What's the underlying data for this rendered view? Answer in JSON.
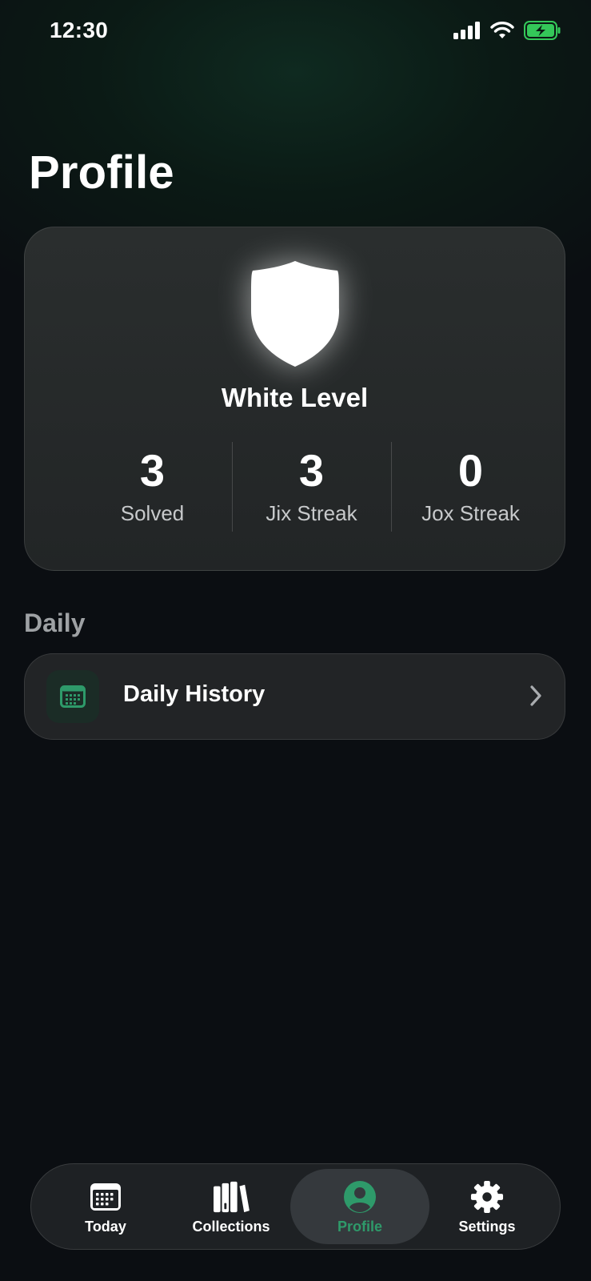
{
  "status_bar": {
    "time": "12:30",
    "battery_color": "#34c759"
  },
  "page": {
    "title": "Profile"
  },
  "profile_card": {
    "badge_icon": "shield-icon",
    "level_name": "White Level",
    "stats": [
      {
        "value": "3",
        "label": "Solved"
      },
      {
        "value": "3",
        "label": "Jix Streak"
      },
      {
        "value": "0",
        "label": "Jox Streak"
      }
    ]
  },
  "daily_section": {
    "label": "Daily",
    "rows": [
      {
        "label": "Daily History",
        "icon": "calendar-icon"
      }
    ]
  },
  "tab_bar": {
    "tabs": [
      {
        "label": "Today",
        "icon": "calendar-icon",
        "active": false
      },
      {
        "label": "Collections",
        "icon": "books-icon",
        "active": false
      },
      {
        "label": "Profile",
        "icon": "person-circle-icon",
        "active": true
      },
      {
        "label": "Settings",
        "icon": "gear-icon",
        "active": false
      }
    ]
  },
  "colors": {
    "accent": "#2e9a6a",
    "background": "#0b0e12",
    "card": "#262a2b"
  }
}
